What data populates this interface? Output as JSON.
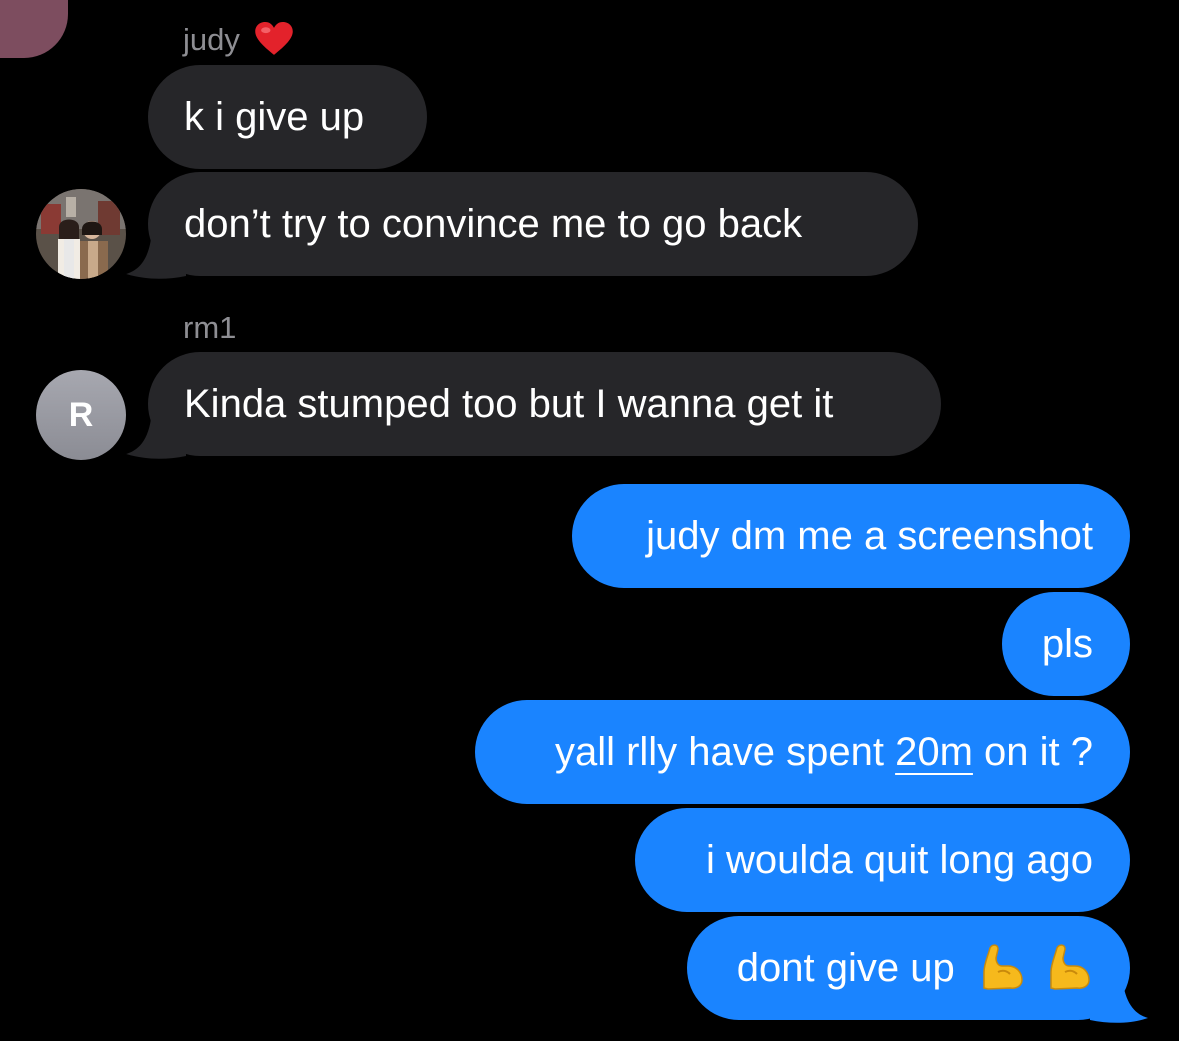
{
  "chat": {
    "sender_1": {
      "name": "judy",
      "badge": "heart-emoji",
      "avatar": "photo-avatar"
    },
    "sender_2": {
      "name": "rm1",
      "avatar_initial": "R"
    },
    "colors": {
      "background": "#000000",
      "incoming_bubble": "#262629",
      "outgoing_bubble": "#1a84ff",
      "sender_name": "#8e8e93",
      "heart": "#e3222b"
    },
    "messages": [
      {
        "from": "judy",
        "text": "k i give up"
      },
      {
        "from": "judy",
        "text": "don’t try to convince me to go back"
      },
      {
        "from": "rm1",
        "text": "Kinda stumped too but I wanna get it"
      },
      {
        "from": "me",
        "text": "judy dm me a screenshot"
      },
      {
        "from": "me",
        "text": "pls"
      },
      {
        "from": "me",
        "text_before": "yall rlly have spent ",
        "link": "20m",
        "text_after": " on it ?"
      },
      {
        "from": "me",
        "text": "i woulda quit long ago"
      },
      {
        "from": "me",
        "text": "dont give up",
        "emojis": [
          "flexed-biceps-emoji",
          "flexed-biceps-emoji"
        ]
      }
    ]
  }
}
